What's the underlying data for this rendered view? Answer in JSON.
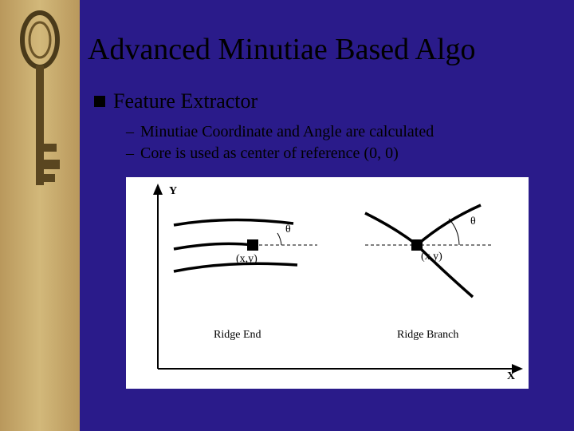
{
  "slide": {
    "title": "Advanced Minutiae Based Algo",
    "bullet": "Feature Extractor",
    "sub1": "Minutiae Coordinate and Angle are calculated",
    "sub2": "Core is used as center of reference (0, 0)"
  },
  "figure": {
    "y_axis": "Y",
    "x_axis": "X",
    "left_label": "Ridge End",
    "right_label": "Ridge Branch",
    "coord": "(x,y)",
    "theta1": "θ",
    "theta2": "θ"
  }
}
